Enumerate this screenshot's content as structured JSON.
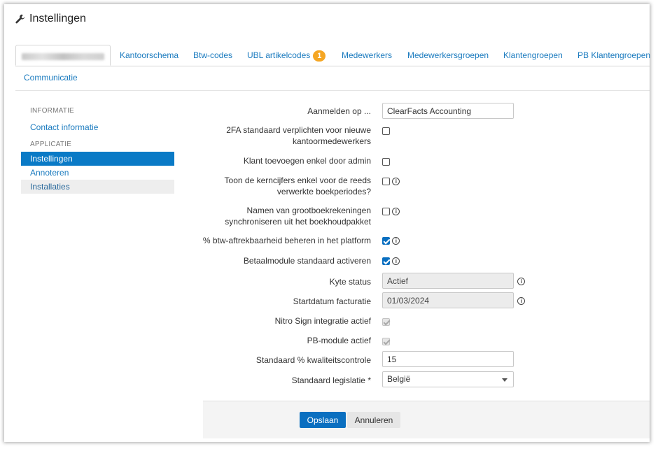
{
  "page": {
    "title": "Instellingen",
    "icon": "wrench-icon"
  },
  "tabs": [
    {
      "label": "",
      "blurred": true,
      "active": true
    },
    {
      "label": "Kantoorschema"
    },
    {
      "label": "Btw-codes"
    },
    {
      "label": "UBL artikelcodes",
      "badge": "1"
    },
    {
      "label": "Medewerkers"
    },
    {
      "label": "Medewerkersgroepen"
    },
    {
      "label": "Klantengroepen"
    },
    {
      "label": "PB Klantengroepen"
    }
  ],
  "tab_row2": {
    "label": "Communicatie"
  },
  "sidebar": {
    "group_info": "INFORMATIE",
    "contact": "Contact informatie",
    "group_app": "APPLICATIE",
    "instellingen": "Instellingen",
    "annoteren": "Annoteren",
    "installaties": "Installaties"
  },
  "form": {
    "aanmelden": {
      "label": "Aanmelden op ...",
      "value": "ClearFacts Accounting"
    },
    "twofa": {
      "label1": "2FA standaard verplichten voor nieuwe",
      "label2": "kantoormedewerkers",
      "checked": false
    },
    "klant_admin": {
      "label": "Klant toevoegen enkel door admin",
      "checked": false
    },
    "kerncijfers": {
      "label1": "Toon de kerncijfers enkel voor de reeds",
      "label2": "verwerkte boekperiodes?",
      "checked": false
    },
    "grootboek": {
      "label1": "Namen van grootboekrekeningen",
      "label2": "synchroniseren uit het boekhoudpakket",
      "checked": false
    },
    "btw": {
      "label": "% btw-aftrekbaarheid beheren in het platform",
      "checked": true
    },
    "betaal": {
      "label": "Betaalmodule standaard activeren",
      "checked": true
    },
    "kyte": {
      "label": "Kyte status",
      "value": "Actief"
    },
    "startdatum": {
      "label": "Startdatum facturatie",
      "value": "01/03/2024"
    },
    "nitro": {
      "label": "Nitro Sign integratie actief",
      "checked": true,
      "disabled": true
    },
    "pb": {
      "label": "PB-module actief",
      "checked": true,
      "disabled": true
    },
    "kwaliteit": {
      "label": "Standaard % kwaliteitscontrole",
      "value": "15"
    },
    "legislatie": {
      "label": "Standaard legislatie *",
      "value": "België"
    }
  },
  "info_glyph": "i",
  "buttons": {
    "save": "Opslaan",
    "cancel": "Annuleren"
  },
  "colors": {
    "accent": "#0a6fc0",
    "link": "#1b7bbf",
    "badge": "#f5a623"
  }
}
